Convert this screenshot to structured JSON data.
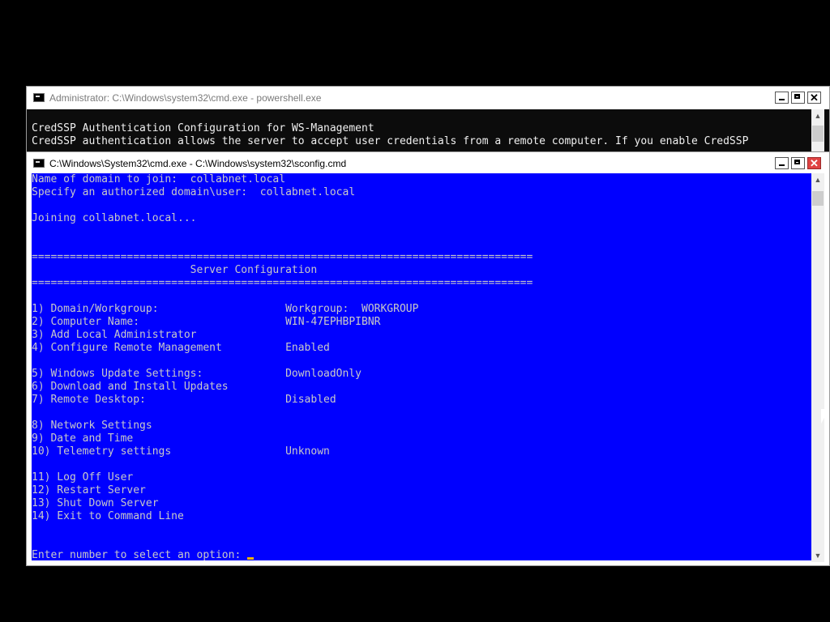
{
  "back_window": {
    "title": "Administrator: C:\\Windows\\system32\\cmd.exe - powershell.exe",
    "lines": [
      "",
      "CredSSP Authentication Configuration for WS-Management",
      "CredSSP authentication allows the server to accept user credentials from a remote computer. If you enable CredSSP"
    ]
  },
  "front_window": {
    "title": "C:\\Windows\\System32\\cmd.exe - C:\\Windows\\system32\\sconfig.cmd",
    "lines": [
      "Name of domain to join:  collabnet.local",
      "Specify an authorized domain\\user:  collabnet.local",
      "",
      "Joining collabnet.local...",
      "",
      "",
      "===============================================================================",
      "                         Server Configuration",
      "===============================================================================",
      "",
      "1) Domain/Workgroup:                    Workgroup:  WORKGROUP",
      "2) Computer Name:                       WIN-47EPHBPIBNR",
      "3) Add Local Administrator",
      "4) Configure Remote Management          Enabled",
      "",
      "5) Windows Update Settings:             DownloadOnly",
      "6) Download and Install Updates",
      "7) Remote Desktop:                      Disabled",
      "",
      "8) Network Settings",
      "9) Date and Time",
      "10) Telemetry settings                  Unknown",
      "",
      "11) Log Off User",
      "12) Restart Server",
      "13) Shut Down Server",
      "14) Exit to Command Line",
      "",
      ""
    ],
    "prompt": "Enter number to select an option: "
  },
  "controls": {
    "minimize": "",
    "maximize": "",
    "close": "✕"
  },
  "colors": {
    "console_blue_bg": "#0000ff",
    "console_black_bg": "#0c0c0c",
    "text": "#c0c0c0",
    "cursor": "#f0b000",
    "close_active": "#e04343"
  },
  "icons": {
    "app": "cmd-icon",
    "scroll_up": "▲",
    "scroll_down": "▼"
  }
}
